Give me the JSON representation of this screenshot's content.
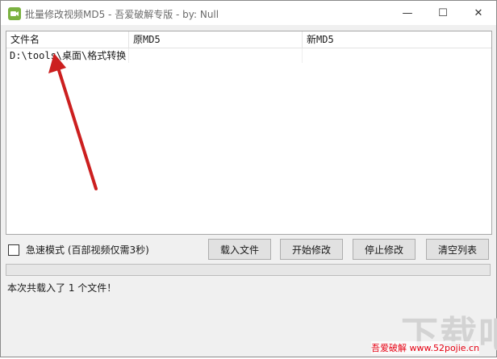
{
  "window": {
    "title": "批量修改视频MD5 - 吾爱破解专版 - by: Null",
    "minimize": "—",
    "maximize": "☐",
    "close": "✕"
  },
  "table": {
    "columns": [
      "文件名",
      "原MD5",
      "新MD5"
    ],
    "rows": [
      {
        "file": "D:\\tools\\桌面\\格式转换",
        "orig_md5": "",
        "new_md5": ""
      }
    ]
  },
  "options": {
    "fast_mode_label": "急速模式 (百部视频仅需3秒)",
    "fast_mode_checked": false
  },
  "buttons": {
    "load": "载入文件",
    "start": "开始修改",
    "stop": "停止修改",
    "clear": "清空列表"
  },
  "progress": {
    "value": 0
  },
  "status_text": "本次共载入了 1 个文件！",
  "watermark": {
    "big": "下载吧",
    "small": "吾爱破解 www.52pojie.cn"
  },
  "colors": {
    "arrow": "#cc1f1f",
    "progress_fill": "#06b025",
    "app_icon": "#7bb241"
  }
}
